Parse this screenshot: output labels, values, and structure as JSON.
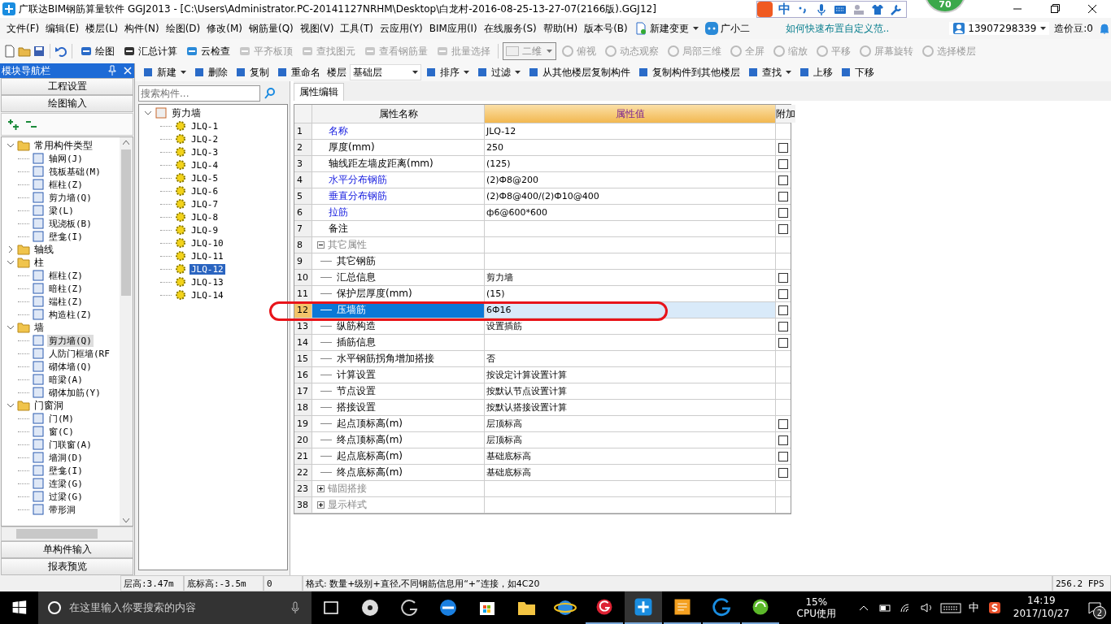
{
  "window": {
    "title": "广联达BIM钢筋算量软件 GGJ2013 - [C:\\Users\\Administrator.PC-20141127NRHM\\Desktop\\白龙村-2016-08-25-13-27-07(2166版).GGJ12]"
  },
  "floating_badge": "70",
  "ime_bar": {
    "mode": "中"
  },
  "menu": [
    "文件(F)",
    "编辑(E)",
    "楼层(L)",
    "构件(N)",
    "绘图(D)",
    "修改(M)",
    "钢筋量(Q)",
    "视图(V)",
    "工具(T)",
    "云应用(Y)",
    "BIM应用(I)",
    "在线服务(S)",
    "帮助(H)",
    "版本号(B)"
  ],
  "menu_extras": {
    "change": "新建变更",
    "assistant": "广小二",
    "tip": "如何快速布置自定义范..",
    "account": "13907298339",
    "beans": "造价豆:0"
  },
  "toolbar1": [
    {
      "label": "绘图",
      "disabled": false
    },
    {
      "label": "汇总计算",
      "disabled": false
    },
    {
      "label": "云检查",
      "disabled": false
    },
    {
      "label": "平齐板顶",
      "disabled": true
    },
    {
      "label": "查找图元",
      "disabled": true
    },
    {
      "label": "查看钢筋量",
      "disabled": true
    },
    {
      "label": "批量选择",
      "disabled": true
    }
  ],
  "view_mode": "二维",
  "toolbar_view": [
    {
      "label": "俯视",
      "disabled": true
    },
    {
      "label": "动态观察",
      "disabled": true
    },
    {
      "label": "局部三维",
      "disabled": true
    },
    {
      "label": "全屏",
      "disabled": true
    },
    {
      "label": "缩放",
      "disabled": true
    },
    {
      "label": "平移",
      "disabled": true
    },
    {
      "label": "屏幕旋转",
      "disabled": true
    },
    {
      "label": "选择楼层",
      "disabled": true
    }
  ],
  "nav": {
    "title": "模块导航栏",
    "top_buttons": [
      "工程设置",
      "绘图输入"
    ],
    "bottom_buttons": [
      "单构件输入",
      "报表预览"
    ]
  },
  "nav_tree": [
    {
      "label": "常用构件类型",
      "expanded": true,
      "children": [
        {
          "label": "轴网(J)",
          "selected": false
        },
        {
          "label": "筏板基础(M)",
          "selected": false
        },
        {
          "label": "框柱(Z)",
          "selected": false
        },
        {
          "label": "剪力墙(Q)",
          "selected": false
        },
        {
          "label": "梁(L)",
          "selected": false
        },
        {
          "label": "现浇板(B)",
          "selected": false
        },
        {
          "label": "壁龛(I)",
          "selected": false
        }
      ]
    },
    {
      "label": "轴线",
      "expanded": false
    },
    {
      "label": "柱",
      "expanded": true,
      "children": [
        {
          "label": "框柱(Z)",
          "selected": false
        },
        {
          "label": "暗柱(Z)",
          "selected": false
        },
        {
          "label": "端柱(Z)",
          "selected": false
        },
        {
          "label": "构造柱(Z)",
          "selected": false
        }
      ]
    },
    {
      "label": "墙",
      "expanded": true,
      "children": [
        {
          "label": "剪力墙(Q)",
          "selected": true
        },
        {
          "label": "人防门框墙(RF",
          "selected": false
        },
        {
          "label": "砌体墙(Q)",
          "selected": false
        },
        {
          "label": "暗梁(A)",
          "selected": false
        },
        {
          "label": "砌体加筋(Y)",
          "selected": false
        }
      ]
    },
    {
      "label": "门窗洞",
      "expanded": true,
      "children": [
        {
          "label": "门(M)",
          "selected": false
        },
        {
          "label": "窗(C)",
          "selected": false
        },
        {
          "label": "门联窗(A)",
          "selected": false
        },
        {
          "label": "墙洞(D)",
          "selected": false
        },
        {
          "label": "壁龛(I)",
          "selected": false
        },
        {
          "label": "连梁(G)",
          "selected": false
        },
        {
          "label": "过梁(G)",
          "selected": false
        },
        {
          "label": "带形洞",
          "selected": false
        }
      ]
    }
  ],
  "toolbar2": [
    {
      "label": "新建",
      "kind": "menu"
    },
    {
      "label": "删除",
      "kind": "button"
    },
    {
      "label": "复制",
      "kind": "button"
    },
    {
      "label": "重命名",
      "kind": "button"
    },
    {
      "label": "楼层",
      "kind": "label"
    },
    {
      "label": "基础层",
      "kind": "select"
    },
    {
      "label": "排序",
      "kind": "menu"
    },
    {
      "label": "过滤",
      "kind": "menu"
    },
    {
      "label": "从其他楼层复制构件",
      "kind": "button"
    },
    {
      "label": "复制构件到其他楼层",
      "kind": "button"
    },
    {
      "label": "查找",
      "kind": "menu"
    },
    {
      "label": "上移",
      "kind": "button"
    },
    {
      "label": "下移",
      "kind": "button"
    }
  ],
  "search": {
    "placeholder": "搜索构件..."
  },
  "component_tree": {
    "label": "剪力墙",
    "expanded": true,
    "children": [
      {
        "label": "JLQ-1",
        "selected": false
      },
      {
        "label": "JLQ-2",
        "selected": false
      },
      {
        "label": "JLQ-3",
        "selected": false
      },
      {
        "label": "JLQ-4",
        "selected": false
      },
      {
        "label": "JLQ-5",
        "selected": false
      },
      {
        "label": "JLQ-6",
        "selected": false
      },
      {
        "label": "JLQ-7",
        "selected": false
      },
      {
        "label": "JLQ-8",
        "selected": false
      },
      {
        "label": "JLQ-9",
        "selected": false
      },
      {
        "label": "JLQ-10",
        "selected": false
      },
      {
        "label": "JLQ-11",
        "selected": false
      },
      {
        "label": "JLQ-12",
        "selected": true
      },
      {
        "label": "JLQ-13",
        "selected": false
      },
      {
        "label": "JLQ-14",
        "selected": false
      }
    ]
  },
  "property_tab": "属性编辑",
  "table": {
    "columns": [
      "属性名称",
      "属性值",
      "附加"
    ],
    "rows": [
      {
        "no": "1",
        "name": "名称",
        "value": "JLQ-12",
        "kind": "link",
        "selected": false
      },
      {
        "no": "2",
        "name": "厚度(mm)",
        "value": "250",
        "kind": "plain",
        "checked": false,
        "selected": false
      },
      {
        "no": "3",
        "name": "轴线距左墙皮距离(mm)",
        "value": "(125)",
        "kind": "plain",
        "checked": false,
        "selected": false
      },
      {
        "no": "4",
        "name": "水平分布钢筋",
        "value": "(2)Ф8@200",
        "kind": "link",
        "checked": false,
        "selected": false
      },
      {
        "no": "5",
        "name": "垂直分布钢筋",
        "value": "(2)Ф8@400/(2)Ф10@400",
        "kind": "link",
        "checked": false,
        "selected": false
      },
      {
        "no": "6",
        "name": "拉筋",
        "value": "ф6@600*600",
        "kind": "link",
        "checked": false,
        "selected": false
      },
      {
        "no": "7",
        "name": "备注",
        "kind": "plain",
        "checked": false,
        "selected": false
      },
      {
        "no": "8",
        "name": "其它属性",
        "kind": "group",
        "expanded": true,
        "selected": false
      },
      {
        "no": "9",
        "name": "其它钢筋",
        "kind": "child",
        "selected": false
      },
      {
        "no": "10",
        "name": "汇总信息",
        "value": "剪力墙",
        "kind": "child",
        "checked": false,
        "selected": false
      },
      {
        "no": "11",
        "name": "保护层厚度(mm)",
        "value": "(15)",
        "kind": "child",
        "checked": false,
        "selected": false
      },
      {
        "no": "12",
        "name": "压墙筋",
        "value": "6Ф16",
        "kind": "child",
        "checked": false,
        "selected": true
      },
      {
        "no": "13",
        "name": "纵筋构造",
        "value": "设置插筋",
        "kind": "child",
        "checked": false,
        "selected": false
      },
      {
        "no": "14",
        "name": "插筋信息",
        "kind": "child",
        "checked": false,
        "selected": false
      },
      {
        "no": "15",
        "name": "水平钢筋拐角增加搭接",
        "value": "否",
        "kind": "child",
        "selected": false
      },
      {
        "no": "16",
        "name": "计算设置",
        "value": "按设定计算设置计算",
        "kind": "child",
        "selected": false
      },
      {
        "no": "17",
        "name": "节点设置",
        "value": "按默认节点设置计算",
        "kind": "child",
        "selected": false
      },
      {
        "no": "18",
        "name": "搭接设置",
        "value": "按默认搭接设置计算",
        "kind": "child",
        "selected": false
      },
      {
        "no": "19",
        "name": "起点顶标高(m)",
        "value": "层顶标高",
        "kind": "child",
        "checked": false,
        "selected": false
      },
      {
        "no": "20",
        "name": "终点顶标高(m)",
        "value": "层顶标高",
        "kind": "child",
        "checked": false,
        "selected": false
      },
      {
        "no": "21",
        "name": "起点底标高(m)",
        "value": "基础底标高",
        "kind": "child",
        "checked": false,
        "selected": false
      },
      {
        "no": "22",
        "name": "终点底标高(m)",
        "value": "基础底标高",
        "kind": "child",
        "checked": false,
        "selected": false
      },
      {
        "no": "23",
        "name": "锚固搭接",
        "kind": "group",
        "expanded": false,
        "selected": false
      },
      {
        "no": "38",
        "name": "显示样式",
        "kind": "group",
        "expanded": false,
        "selected": false
      }
    ]
  },
  "status_bar": [
    "层高:3.47m",
    "底标高:-3.5m",
    "0",
    "格式: 数量+级别+直径,不同钢筋信息用“+”连接，如4C20",
    "256.2 FPS"
  ],
  "taskbar": {
    "search_placeholder": "在这里输入你要搜索的内容",
    "cpu_percent": "15%",
    "cpu_label": "CPU使用",
    "ime": "中",
    "time": "14:19",
    "date": "2017/10/27",
    "notifications": "2"
  }
}
